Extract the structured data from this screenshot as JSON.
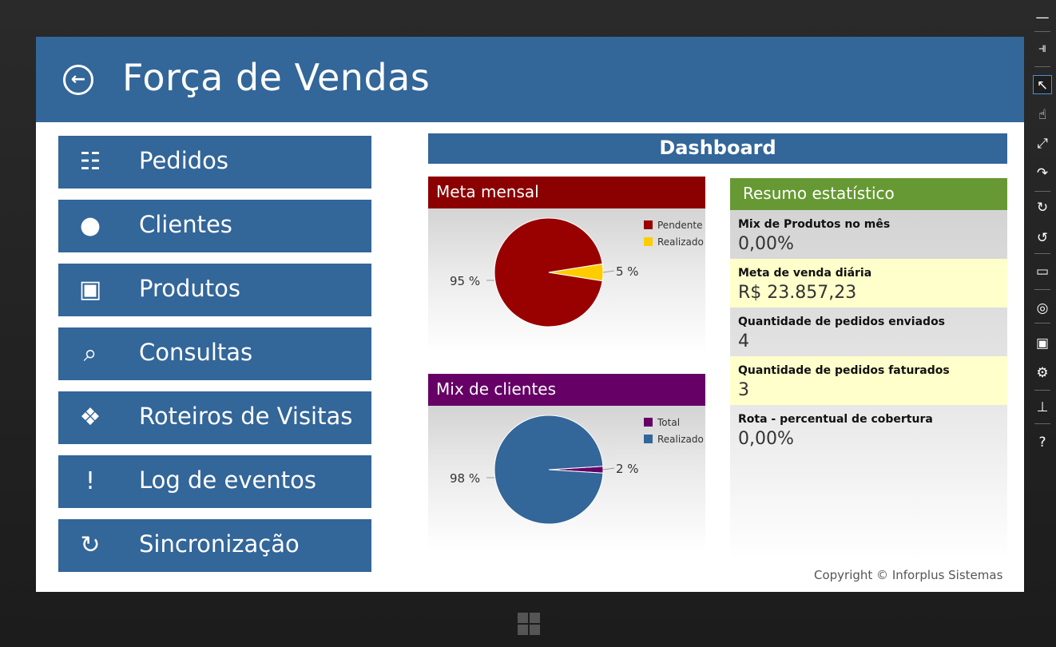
{
  "header": {
    "title": "Força de Vendas",
    "back_icon": "arrow-left-icon"
  },
  "menu": [
    {
      "label": "Pedidos",
      "icon": "documents-icon",
      "glyph": "☷"
    },
    {
      "label": "Clientes",
      "icon": "user-icon",
      "glyph": "●"
    },
    {
      "label": "Produtos",
      "icon": "box-icon",
      "glyph": "▣"
    },
    {
      "label": "Consultas",
      "icon": "magnifier-icon",
      "glyph": "⌕"
    },
    {
      "label": "Roteiros de Visitas",
      "icon": "puzzle-icon",
      "glyph": "❖"
    },
    {
      "label": "Log de eventos",
      "icon": "exclamation-icon",
      "glyph": "!"
    },
    {
      "label": "Sincronização",
      "icon": "sync-icon",
      "glyph": "↻"
    }
  ],
  "dashboard": {
    "title": "Dashboard"
  },
  "charts": {
    "meta": {
      "title": "Meta mensal",
      "legend": [
        "Pendente",
        "Realizado"
      ],
      "colors": [
        "#990000",
        "#ffcc00"
      ],
      "values": [
        95,
        5
      ],
      "labels": [
        "95 %",
        "5 %"
      ]
    },
    "mix": {
      "title": "Mix de clientes",
      "legend": [
        "Total",
        "Realizado"
      ],
      "colors": [
        "#660066",
        "#336699"
      ],
      "values": [
        2,
        98
      ],
      "labels": [
        "2 %",
        "98 %"
      ]
    }
  },
  "chart_data": [
    {
      "type": "pie",
      "title": "Meta mensal",
      "categories": [
        "Pendente",
        "Realizado"
      ],
      "values": [
        95,
        5
      ],
      "unit": "%"
    },
    {
      "type": "pie",
      "title": "Mix de clientes",
      "categories": [
        "Total",
        "Realizado"
      ],
      "values": [
        2,
        98
      ],
      "unit": "%"
    }
  ],
  "stats": {
    "title": "Resumo estatístico",
    "items": [
      {
        "label": "Mix de Produtos no mês",
        "value": "0,00%"
      },
      {
        "label": "Meta de venda diária",
        "value": "R$ 23.857,23"
      },
      {
        "label": "Quantidade de pedidos enviados",
        "value": "4"
      },
      {
        "label": "Quantidade de pedidos faturados",
        "value": "3"
      },
      {
        "label": "Rota - percentual de cobertura",
        "value": "0,00%"
      }
    ]
  },
  "footer": {
    "copyright": "Copyright © Inforplus Sistemas"
  },
  "colors": {
    "primary": "#336699",
    "meta_header": "#8b0000",
    "mix_header": "#660066",
    "stats_header": "#669933",
    "highlight": "#ffffcc"
  },
  "charms": [
    "minimize-icon",
    "pin-icon",
    "pointer-icon",
    "touch-icon",
    "pinch-icon",
    "rotate-touch-icon",
    "rotate-cw-icon",
    "rotate-ccw-icon",
    "monitor-icon",
    "globe-icon",
    "camera-icon",
    "settings-icon",
    "network-icon",
    "help-icon"
  ]
}
